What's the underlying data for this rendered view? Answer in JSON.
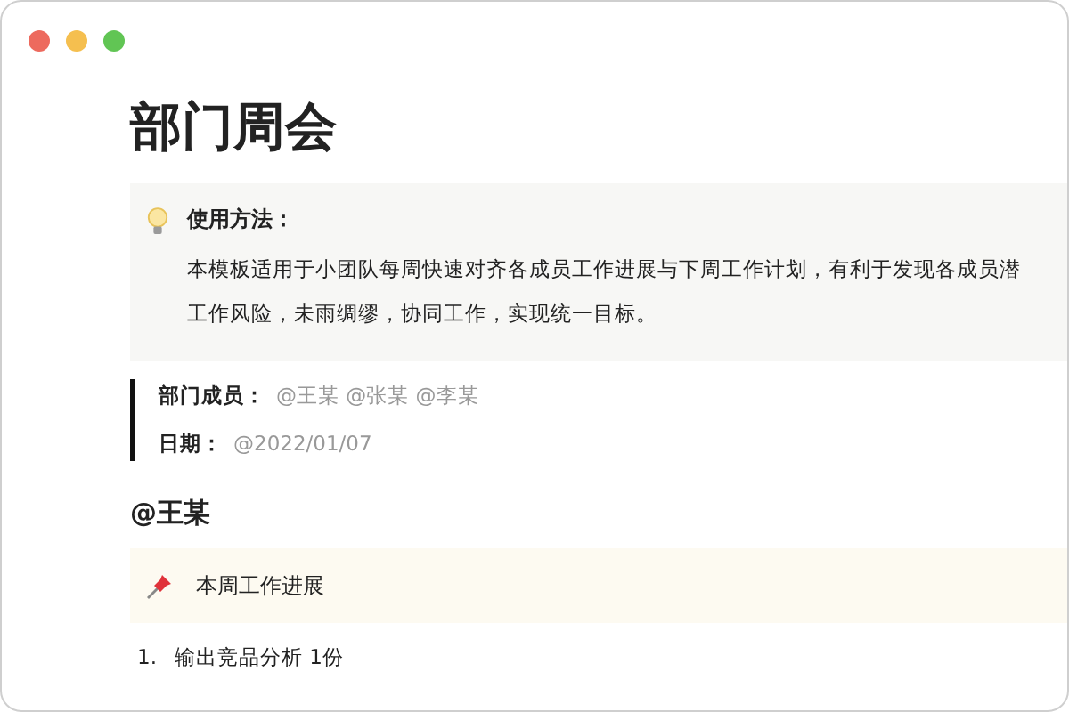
{
  "window": {
    "controls": [
      {
        "color": "#ed6a5e"
      },
      {
        "color": "#f5bf4f"
      },
      {
        "color": "#61c554"
      }
    ]
  },
  "title": "部门周会",
  "usage_callout": {
    "heading": "使用方法：",
    "lines": [
      "本模板适用于小团队每周快速对齐各成员工作进展与下周工作计划，有利于发现各成员潜",
      "工作风险，未雨绸缪，协同工作，实现统一目标。"
    ]
  },
  "properties": [
    {
      "label": "部门成员：",
      "value": "@王某 @张某 @李某"
    },
    {
      "label": "日期：",
      "value": "@2022/01/07"
    }
  ],
  "section": {
    "heading": "@王某",
    "callout": "本周工作进展",
    "list": [
      {
        "number": "1.",
        "text": "输出竞品分析 1份"
      }
    ]
  }
}
